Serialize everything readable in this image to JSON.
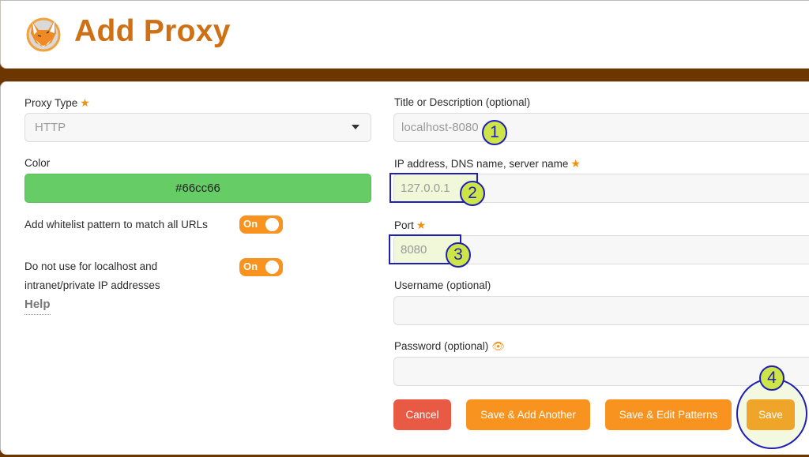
{
  "header": {
    "title": "Add Proxy",
    "logo_icon": "fox-icon"
  },
  "left": {
    "proxy_type": {
      "label": "Proxy Type",
      "required_icon": "star-icon",
      "value": "HTTP"
    },
    "color": {
      "label": "Color",
      "value": "#66cc66"
    },
    "whitelist": {
      "label": "Add whitelist pattern to match all URLs",
      "state": "On"
    },
    "localhost": {
      "label_line1": "Do not use for localhost and",
      "label_line2": "intranet/private IP addresses",
      "state": "On"
    },
    "help_link": "Help"
  },
  "right": {
    "title": {
      "label": "Title or Description (optional)",
      "placeholder": "localhost-8080"
    },
    "address": {
      "label": "IP address, DNS name, server name",
      "required_icon": "star-icon",
      "placeholder": "127.0.0.1"
    },
    "port": {
      "label": "Port",
      "required_icon": "star-icon",
      "placeholder": "8080"
    },
    "username": {
      "label": "Username (optional)",
      "value": ""
    },
    "password": {
      "label": "Password (optional)",
      "toggle_icon": "eye-icon",
      "value": ""
    }
  },
  "buttons": {
    "cancel": "Cancel",
    "save_add_another": "Save & Add Another",
    "save_edit_patterns": "Save & Edit Patterns",
    "save": "Save"
  },
  "annotations": [
    "1",
    "2",
    "3",
    "4"
  ],
  "colors": {
    "brand_brown": "#6b3600",
    "title_orange": "#d07014",
    "accent_orange": "#f7931e",
    "cancel_red": "#e95a45",
    "annotation_blue": "#1e1fb8",
    "annotation_lime": "#cde547"
  }
}
